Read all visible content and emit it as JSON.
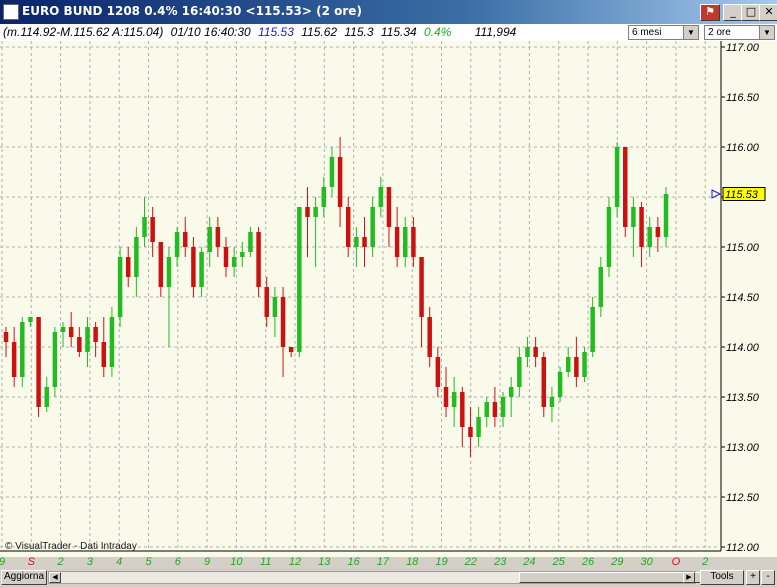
{
  "window": {
    "title": "EURO BUND 1208 0.4% 16:40:30  <115.53> (2 ore)"
  },
  "infobar": {
    "range": "(m.114.92-M.115.62 A:115.04)",
    "datetime": "01/10 16:40:30",
    "last": "115.53",
    "high": "115.62",
    "low": "115.3",
    "open": "115.34",
    "change": "0.4%",
    "volume": "111,994",
    "period_select": "6 mesi",
    "interval_select": "2 ore"
  },
  "watermark": "© VisualTrader - Dati Intraday",
  "bottombar": {
    "refresh_label": "Aggiorna",
    "tools_label": "Tools",
    "plus_label": "+",
    "minus_label": "-"
  },
  "colors": {
    "up": "#22bb22",
    "down": "#cc1111",
    "background": "#fafaea",
    "grid": "#b0b0b0",
    "price_marker": "#ffff00",
    "last_text": "#1a1acc",
    "change_text": "#22aa22"
  },
  "chart_data": {
    "type": "candlestick",
    "title": "EURO BUND 1208",
    "ylim": [
      112.0,
      117.0
    ],
    "y_ticks": [
      "117.00",
      "116.50",
      "116.00",
      "115.50",
      "115.00",
      "114.50",
      "114.00",
      "113.50",
      "113.00",
      "112.50",
      "112.00"
    ],
    "x_labels": [
      "9",
      "S",
      "2",
      "3",
      "4",
      "5",
      "6",
      "9",
      "10",
      "11",
      "12",
      "13",
      "16",
      "17",
      "18",
      "19",
      "22",
      "23",
      "24",
      "25",
      "26",
      "29",
      "30",
      "O",
      "2"
    ],
    "last_price_label": "115.53",
    "candles": [
      [
        114.15,
        114.2,
        113.9,
        114.05
      ],
      [
        114.05,
        114.2,
        113.6,
        113.7
      ],
      [
        113.7,
        114.3,
        113.6,
        114.25
      ],
      [
        114.25,
        114.3,
        114.2,
        114.3
      ],
      [
        114.3,
        114.3,
        113.3,
        113.4
      ],
      [
        113.4,
        113.7,
        113.35,
        113.6
      ],
      [
        113.6,
        114.2,
        113.5,
        114.15
      ],
      [
        114.15,
        114.25,
        114.0,
        114.2
      ],
      [
        114.2,
        114.35,
        114.0,
        114.1
      ],
      [
        114.1,
        114.2,
        113.9,
        113.95
      ],
      [
        113.95,
        114.3,
        113.8,
        114.2
      ],
      [
        114.2,
        114.25,
        113.9,
        114.05
      ],
      [
        114.05,
        114.3,
        113.7,
        113.8
      ],
      [
        113.8,
        114.4,
        113.7,
        114.3
      ],
      [
        114.3,
        115.0,
        114.2,
        114.9
      ],
      [
        114.9,
        115.0,
        114.6,
        114.7
      ],
      [
        114.7,
        115.2,
        114.5,
        115.1
      ],
      [
        115.1,
        115.5,
        115.0,
        115.3
      ],
      [
        115.3,
        115.4,
        114.9,
        115.05
      ],
      [
        115.05,
        114.9,
        114.5,
        114.6
      ],
      [
        114.6,
        115.0,
        114.0,
        114.9
      ],
      [
        114.9,
        115.2,
        114.8,
        115.15
      ],
      [
        115.15,
        115.3,
        114.9,
        115.0
      ],
      [
        115.0,
        115.1,
        114.5,
        114.6
      ],
      [
        114.6,
        115.0,
        114.5,
        114.95
      ],
      [
        114.95,
        115.3,
        114.8,
        115.2
      ],
      [
        115.2,
        115.3,
        114.9,
        115.0
      ],
      [
        115.0,
        115.1,
        114.7,
        114.8
      ],
      [
        114.8,
        115.0,
        114.7,
        114.9
      ],
      [
        114.9,
        115.05,
        114.8,
        114.95
      ],
      [
        114.95,
        115.2,
        114.9,
        115.15
      ],
      [
        115.15,
        115.2,
        114.5,
        114.6
      ],
      [
        114.6,
        114.7,
        114.2,
        114.3
      ],
      [
        114.3,
        114.6,
        114.1,
        114.5
      ],
      [
        114.5,
        114.6,
        113.7,
        114.0
      ],
      [
        114.0,
        114.0,
        113.9,
        113.95
      ],
      [
        113.95,
        115.0,
        113.9,
        115.4
      ],
      [
        115.4,
        115.6,
        114.9,
        115.3
      ],
      [
        115.3,
        115.5,
        114.8,
        115.4
      ],
      [
        115.4,
        115.7,
        115.3,
        115.6
      ],
      [
        115.6,
        116.0,
        115.5,
        115.9
      ],
      [
        115.9,
        116.1,
        115.2,
        115.4
      ],
      [
        115.4,
        115.5,
        114.9,
        115.0
      ],
      [
        115.0,
        115.2,
        114.8,
        115.1
      ],
      [
        115.1,
        115.3,
        114.8,
        115.0
      ],
      [
        115.0,
        115.5,
        114.9,
        115.4
      ],
      [
        115.4,
        115.7,
        115.3,
        115.6
      ],
      [
        115.6,
        115.6,
        115.0,
        115.2
      ],
      [
        115.2,
        115.4,
        114.8,
        114.9
      ],
      [
        114.9,
        115.3,
        114.8,
        115.2
      ],
      [
        115.2,
        115.3,
        114.8,
        114.9
      ],
      [
        114.9,
        114.6,
        114.0,
        114.3
      ],
      [
        114.3,
        114.4,
        113.8,
        113.9
      ],
      [
        113.9,
        114.0,
        113.5,
        113.6
      ],
      [
        113.6,
        113.8,
        113.3,
        113.4
      ],
      [
        113.4,
        113.7,
        113.2,
        113.55
      ],
      [
        113.55,
        113.6,
        113.0,
        113.2
      ],
      [
        113.2,
        113.4,
        112.9,
        113.1
      ],
      [
        113.1,
        113.4,
        113.0,
        113.3
      ],
      [
        113.3,
        113.5,
        113.2,
        113.45
      ],
      [
        113.45,
        113.6,
        113.2,
        113.3
      ],
      [
        113.3,
        113.55,
        113.2,
        113.5
      ],
      [
        113.5,
        113.7,
        113.3,
        113.6
      ],
      [
        113.6,
        114.0,
        113.5,
        113.9
      ],
      [
        113.9,
        114.1,
        113.8,
        114.0
      ],
      [
        114.0,
        114.1,
        113.8,
        113.9
      ],
      [
        113.9,
        113.95,
        113.3,
        113.4
      ],
      [
        113.4,
        113.6,
        113.25,
        113.5
      ],
      [
        113.5,
        113.8,
        113.45,
        113.75
      ],
      [
        113.75,
        114.0,
        113.7,
        113.9
      ],
      [
        113.9,
        114.1,
        113.6,
        113.7
      ],
      [
        113.7,
        114.0,
        113.65,
        113.95
      ],
      [
        113.95,
        114.5,
        113.9,
        114.4
      ],
      [
        114.4,
        114.9,
        114.3,
        114.8
      ],
      [
        114.8,
        115.5,
        114.7,
        115.4
      ],
      [
        115.4,
        116.05,
        115.3,
        116.0
      ],
      [
        116.0,
        116.0,
        115.1,
        115.2
      ],
      [
        115.2,
        115.5,
        114.9,
        115.4
      ],
      [
        115.4,
        115.45,
        114.8,
        115.0
      ],
      [
        115.0,
        115.3,
        114.9,
        115.2
      ],
      [
        115.2,
        115.3,
        114.95,
        115.1
      ],
      [
        115.1,
        115.6,
        115.0,
        115.53
      ]
    ]
  }
}
